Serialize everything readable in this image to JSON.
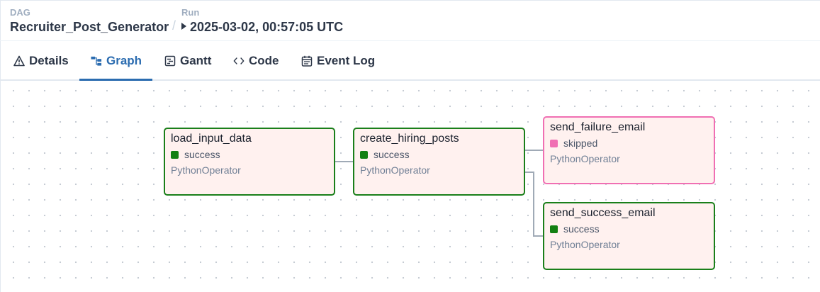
{
  "header": {
    "dag_label": "DAG",
    "dag_name": "Recruiter_Post_Generator",
    "separator": "/",
    "run_label": "Run",
    "run_value": "2025-03-02, 00:57:05 UTC"
  },
  "tabs": [
    {
      "label": "Details",
      "icon": "warning-triangle-icon"
    },
    {
      "label": "Graph",
      "icon": "graph-icon",
      "active": true
    },
    {
      "label": "Gantt",
      "icon": "gantt-icon"
    },
    {
      "label": "Code",
      "icon": "code-icon"
    },
    {
      "label": "Event Log",
      "icon": "calendar-icon"
    }
  ],
  "graph": {
    "nodes": [
      {
        "task_id": "load_input_data",
        "state": "success",
        "operator": "PythonOperator",
        "state_color": "#128012"
      },
      {
        "task_id": "create_hiring_posts",
        "state": "success",
        "operator": "PythonOperator",
        "state_color": "#128012"
      },
      {
        "task_id": "send_failure_email",
        "state": "skipped",
        "operator": "PythonOperator",
        "state_color": "#f06fb3"
      },
      {
        "task_id": "send_success_email",
        "state": "success",
        "operator": "PythonOperator",
        "state_color": "#128012"
      }
    ],
    "edges": [
      [
        "load_input_data",
        "create_hiring_posts"
      ],
      [
        "create_hiring_posts",
        "send_failure_email"
      ],
      [
        "create_hiring_posts",
        "send_success_email"
      ]
    ]
  },
  "colors": {
    "accent": "#2b6cb0",
    "success": "#128012",
    "skipped": "#f06fb3",
    "node_bg": "#fff1ef"
  }
}
